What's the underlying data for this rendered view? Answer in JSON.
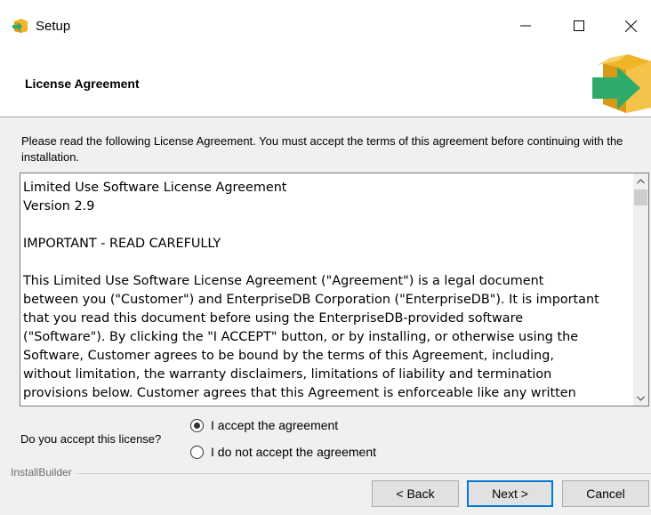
{
  "window": {
    "title": "Setup",
    "minimize_icon": "minimize-icon",
    "maximize_icon": "maximize-icon",
    "close_icon": "close-icon"
  },
  "header": {
    "title": "License Agreement",
    "logo_icon": "box-arrow-icon"
  },
  "instructions": "Please read the following License Agreement. You must accept the terms of this agreement before continuing with the installation.",
  "license": {
    "lines": [
      "Limited Use Software License Agreement",
      "Version 2.9",
      "",
      "IMPORTANT - READ CAREFULLY",
      "",
      "This Limited Use Software License Agreement (\"Agreement\") is a legal document",
      "between you (\"Customer\") and EnterpriseDB Corporation (\"EnterpriseDB\"). It is important",
      "that you read this document before using the EnterpriseDB-provided software",
      "(\"Software\"). By clicking the \"I ACCEPT\" button, or by installing, or otherwise using the",
      "Software, Customer agrees to be bound by the terms of this Agreement, including,",
      "without limitation, the warranty disclaimers, limitations of liability and termination",
      "provisions below. Customer agrees that this Agreement is enforceable like any written"
    ]
  },
  "acceptance": {
    "question": "Do you accept this license?",
    "options": [
      {
        "label": "I accept the agreement",
        "selected": true
      },
      {
        "label": "I do not accept the agreement",
        "selected": false
      }
    ]
  },
  "footer": {
    "brand": "InstallBuilder",
    "back_label": "< Back",
    "next_label": "Next >",
    "cancel_label": "Cancel"
  },
  "colors": {
    "accent": "#0078d7",
    "logo_box": "#f0b429",
    "logo_arrow": "#2eaa6b"
  }
}
